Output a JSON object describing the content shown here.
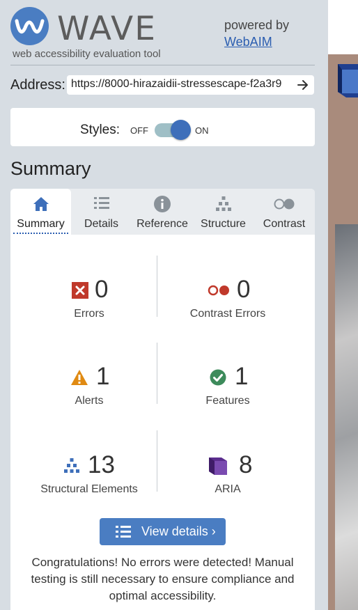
{
  "header": {
    "logo_text": "WAVE",
    "tagline": "web accessibility evaluation tool",
    "powered_by": "powered by",
    "webaim_link": "WebAIM"
  },
  "address": {
    "label": "Address:",
    "value": "https://8000-hirazaidii-stressescape-f2a3r9"
  },
  "styles": {
    "label": "Styles:",
    "off": "OFF",
    "on": "ON",
    "enabled": true
  },
  "summary_heading": "Summary",
  "tabs": [
    {
      "label": "Summary",
      "icon": "home-icon",
      "active": true
    },
    {
      "label": "Details",
      "icon": "list-icon",
      "active": false
    },
    {
      "label": "Reference",
      "icon": "info-icon",
      "active": false
    },
    {
      "label": "Structure",
      "icon": "hierarchy-icon",
      "active": false
    },
    {
      "label": "Contrast",
      "icon": "contrast-icon",
      "active": false
    }
  ],
  "stats": {
    "errors": {
      "count": "0",
      "label": "Errors",
      "icon": "error-icon"
    },
    "contrast_errors": {
      "count": "0",
      "label": "Contrast Errors",
      "icon": "contrast-error-icon"
    },
    "alerts": {
      "count": "1",
      "label": "Alerts",
      "icon": "alert-icon"
    },
    "features": {
      "count": "1",
      "label": "Features",
      "icon": "feature-icon"
    },
    "structural": {
      "count": "13",
      "label": "Structural Elements",
      "icon": "structure-icon"
    },
    "aria": {
      "count": "8",
      "label": "ARIA",
      "icon": "aria-icon"
    }
  },
  "view_details_button": "View details ›",
  "congrats_message": "Congratulations! No errors were detected! Manual testing is still necessary to ensure compliance and optimal accessibility.",
  "colors": {
    "sidebar_bg": "#d7dde3",
    "accent": "#4a7dc2",
    "error": "#c0392b",
    "alert": "#e08a12",
    "feature": "#3d8b5b",
    "aria": "#5b2d8e"
  }
}
